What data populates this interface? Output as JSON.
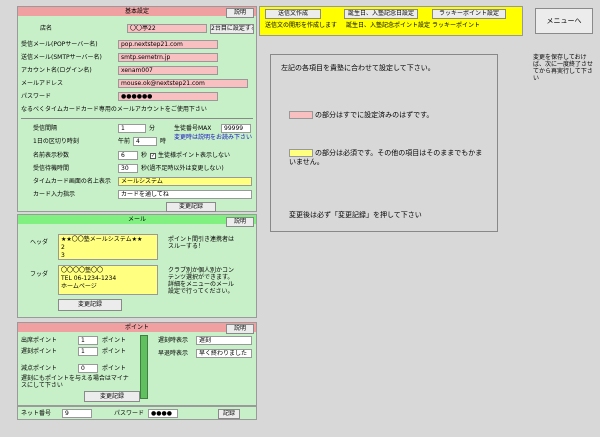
{
  "basic": {
    "header": "基本設定",
    "help": "説明",
    "shop_label": "店名",
    "shop_value": "〇〇亭22",
    "second_shop_btn": "2台目に設定する",
    "pop_label": "受信メール(POPサーバー名)",
    "pop_value": "pop.nextstep21.com",
    "smtp_label": "送信メール(SMTPサーバー名)",
    "smtp_value": "smtp.semetrn.jp",
    "account_label": "アカウント名(ログイン名)",
    "account_value": "xenam007",
    "mail_label": "メールアドレス",
    "mail_value": "mouse.ok@nextstep21.com",
    "password_label": "パスワード",
    "password_value": "●●●●●●",
    "note": "なるべくタイムカードカード専用のメールアカウントをご使用下さい",
    "interval_label": "受信間隔",
    "interval_value": "1",
    "interval_unit": "分",
    "max_no_label": "生徒番号MAX",
    "max_no_value": "99999",
    "max_no_note": "変更時は説明をお読み下さい",
    "work_start_label": "1日の区切り時刻",
    "work_start_prefix": "午前",
    "work_start_value": "4",
    "work_start_unit": "時",
    "name_disp_label": "名前表示秒数",
    "name_disp_value": "6",
    "name_disp_unit": "秒",
    "point_hide_label": "生徒様ポイント表示しない",
    "wait_label": "受信待機時間",
    "wait_value": "30",
    "wait_note": "秒(過不足時以外は変更しない)",
    "tc_title_label": "タイムカード画面の名上表示",
    "tc_title_value": "メールシステム",
    "card_input_label": "カード入力指示",
    "card_input_value": "カードを通してね",
    "save_btn": "変更記録"
  },
  "mail": {
    "header": "メール",
    "help": "説明",
    "head_label": "ヘッダ",
    "head_text": "★★〇〇塾メールシステム★★\n2\n3",
    "footer_label": "フッダ",
    "footer_text": "〇〇〇〇塾〇〇\nTEL 06-1234-1234\nホームページ",
    "head_note": "ポイント間引き連携者はスルーする！",
    "footer_note": "クラブ別か個人別かコンテンツ選択ができます。詳細をメニューのメール設定で行ってください。",
    "save_btn": "変更記録"
  },
  "point": {
    "header": "ポイント",
    "help": "説明",
    "attend_label": "出席ポイント",
    "attend_value": "1",
    "late_label": "遅刻ポイント",
    "late_value": "1",
    "absent_label": "減点ポイント",
    "absent_value": "0",
    "unit": "ポイント",
    "note": "遅刻にもポイントを与える場合はマイナスにして下さい",
    "late_disp_label": "遅刻時表示",
    "late_disp_value": "遅刻",
    "early_disp_label": "早退時表示",
    "early_disp_value": "早く終わりました",
    "save_btn": "変更記録"
  },
  "net": {
    "no_label": "ネット番号",
    "no_value": "9",
    "password_label": "パスワード",
    "password_value": "●●●●",
    "save_btn": "記録"
  },
  "top": {
    "btn_send": "送信文作成",
    "btn_birthday": "誕生日、入塾記念日設定",
    "btn_lucky": "ラッキーポイント設定",
    "text_send": "送信文の開形を作成します",
    "text_birthday": "誕生日、入塾記念ポイント設定",
    "text_lucky": "ラッキーポイント"
  },
  "menu_btn": "メニューへ",
  "side_note": "変更を保存しておけば、次に一度終了させてから再実行して下さい",
  "info": {
    "line1": "左記の各項目を貴塾に合わせて設定して下さい。",
    "line2": "の部分はすでに設定済みのはずです。",
    "line3": "の部分は必須です。その他の項目はそのままでもかまいません。",
    "line4": "変更後は必ず「変更記録」を押して下さい"
  },
  "colors": {
    "panel": "#c8f0c8",
    "pink": "#f8c0c0",
    "yellow": "#ffff80",
    "green_header": "#80f080"
  }
}
